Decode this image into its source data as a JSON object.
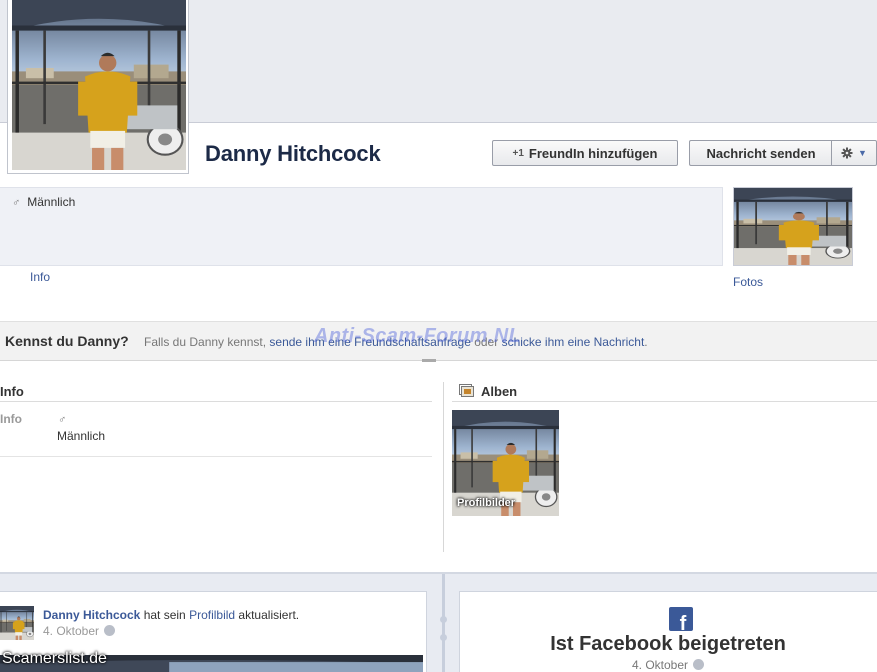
{
  "profile": {
    "name": "Danny Hitchcock"
  },
  "actions": {
    "add_friend_label": "FreundIn hinzufügen",
    "send_message_label": "Nachricht senden",
    "gear_icon": "gear-icon",
    "caret_icon": "chevron-down-icon"
  },
  "intro": {
    "gender_symbol": "♂",
    "gender": "Männlich",
    "info_link": "Info",
    "photos_link": "Fotos"
  },
  "know_bar": {
    "title": "Kennst du Danny?",
    "text_prefix": "Falls du Danny kennst, ",
    "link_friend_request": "sende ihm eine Freundschaftsanfrage",
    "text_middle": " oder ",
    "link_message": "schicke ihm eine Nachricht",
    "text_suffix": "."
  },
  "watermarks": {
    "forum": "Anti-Scam-Forum.NL",
    "site": "Scamerslist.de"
  },
  "info_section": {
    "title": "Info",
    "row_label": "Info",
    "gender_symbol": "♂",
    "gender": "Männlich"
  },
  "albums_section": {
    "title": "Alben",
    "album_label": "Profilbilder"
  },
  "timeline": {
    "post": {
      "author": "Danny Hitchcock",
      "text_before": " hat sein ",
      "link": "Profilbild",
      "text_after": " aktualisiert.",
      "date": "4. Oktober"
    },
    "joined": {
      "logo_letter": "f",
      "title": "Ist Facebook beigetreten",
      "date": "4. Oktober"
    }
  },
  "colors": {
    "brand": "#3b5998",
    "name": "#1c2a47",
    "cover": "#e9ebf0",
    "timeline_bg": "#e8ebf2"
  }
}
